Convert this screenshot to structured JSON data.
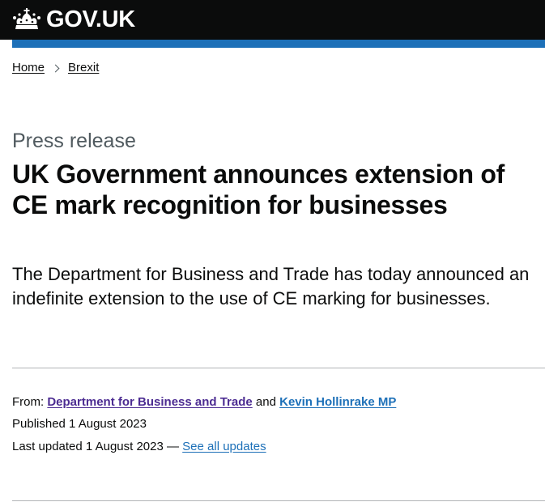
{
  "header": {
    "logo_text": "GOV.UK",
    "logo_icon": "crown-icon",
    "background_color": "#0b0c0c",
    "accent_color": "#1d70b8"
  },
  "breadcrumb": {
    "items": [
      {
        "label": "Home"
      },
      {
        "label": "Brexit"
      }
    ],
    "separator_icon": "chevron-right-icon"
  },
  "article": {
    "caption": "Press release",
    "title": "UK Government announces extension of CE mark recognition for businesses",
    "lead": "The Department for Business and Trade has today announced an indefinite extension to the use of CE marking for businesses."
  },
  "metadata": {
    "from_label": "From:",
    "organisation": "Department for Business and Trade",
    "conjunction": "and",
    "person": "Kevin Hollinrake MP",
    "published": "Published 1 August 2023",
    "last_updated": "Last updated 1 August 2023 —",
    "see_all_updates": "See all updates",
    "organisation_link_color": "#4c2c92",
    "link_color": "#1d70b8"
  }
}
